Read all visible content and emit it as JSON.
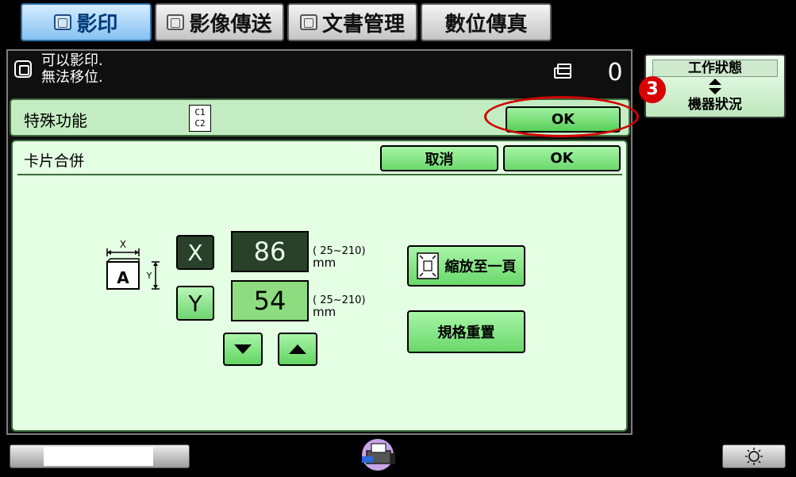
{
  "tabs": [
    {
      "label": "影印",
      "icon": "copy-icon",
      "active": true
    },
    {
      "label": "影像傳送",
      "icon": "image-send-icon",
      "active": false
    },
    {
      "label": "文書管理",
      "icon": "document-filing-icon",
      "active": false
    },
    {
      "label": "數位傳真",
      "icon": "fax-icon",
      "active": false
    }
  ],
  "status": {
    "line1": "可以影印.",
    "line2": "無法移位.",
    "copy_count": "0"
  },
  "job_status": {
    "top_label": "工作狀態",
    "bottom_label": "機器狀況"
  },
  "callout": {
    "number": "3",
    "color": "#d80000"
  },
  "special_functions": {
    "title": "特殊功能",
    "icon_text": [
      "C1",
      "C2"
    ],
    "ok_label": "OK"
  },
  "card_shot": {
    "title": "卡片合併",
    "cancel_label": "取消",
    "ok_label": "OK",
    "diagram": {
      "x_label": "X",
      "y_label": "Y",
      "paper_letter": "A"
    },
    "x": {
      "axis_label": "X",
      "value": "86",
      "range": "( 25~210)",
      "unit": "mm"
    },
    "y": {
      "axis_label": "Y",
      "value": "54",
      "range": "( 25~210)",
      "unit": "mm"
    },
    "fit_label": "縮放至一頁",
    "reset_label": "規格重置"
  },
  "colors": {
    "accent_green": "#58cf58",
    "panel_green": "#e5ffe4",
    "dark_field": "#294029",
    "active_tab": "#86c2f2",
    "highlight_ring": "#d00000"
  }
}
